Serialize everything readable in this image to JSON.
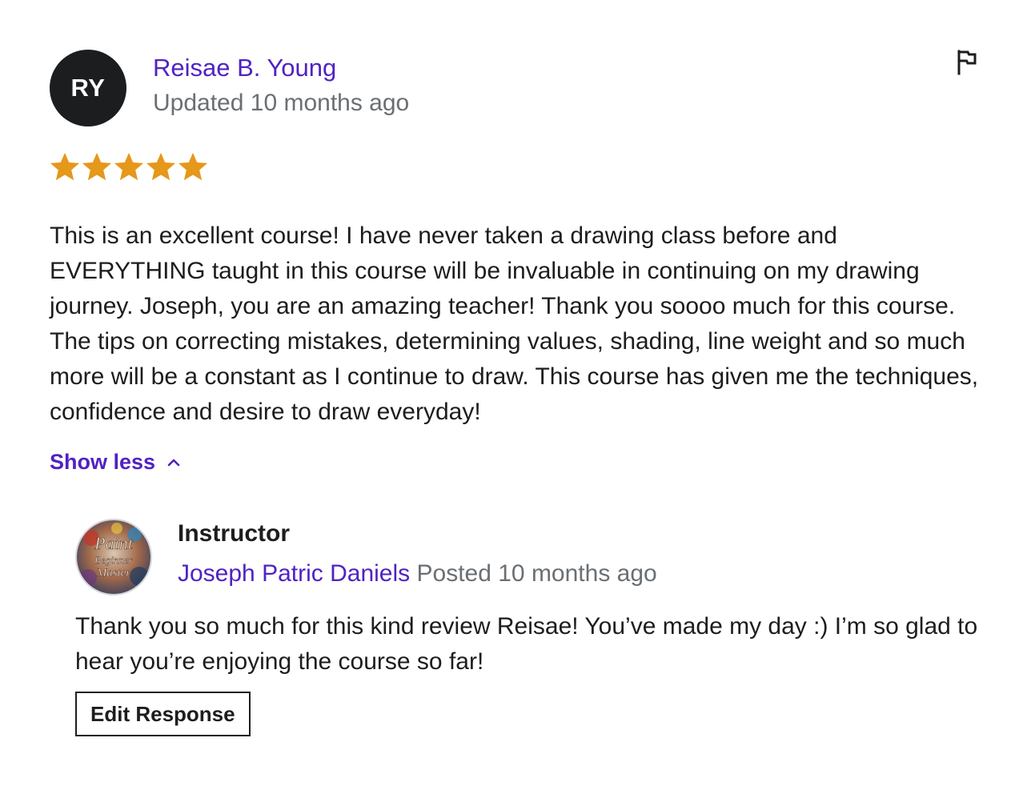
{
  "review": {
    "avatar_initials": "RY",
    "reviewer_name": "Reisae B. Young",
    "updated_text": "Updated 10 months ago",
    "rating": 5,
    "rating_max": 5,
    "star_color": "#e59819",
    "text": "This is an excellent course! I have never taken a drawing class before and EVERYTHING taught in this course will be invaluable in continuing on my drawing journey. Joseph, you are an amazing teacher! Thank you soooo much for this course. The tips on correcting mistakes, determining values, shading, line weight and so much more will be a constant as I continue to draw. This course has given me the techniques, confidence and desire to draw everyday!",
    "show_less_label": "Show less",
    "flag_icon": "flag-icon"
  },
  "response": {
    "role_label": "Instructor",
    "instructor_name": "Joseph Patric Daniels",
    "posted_text": "Posted 10 months ago",
    "text": "Thank you so much for this kind review Reisae! You’ve made my day :) I’m so glad to hear you’re enjoying the course so far!",
    "edit_button_label": "Edit Response",
    "avatar_text_lines": [
      "Paint",
      "Beginner",
      "Master"
    ]
  },
  "colors": {
    "accent": "#5022c3",
    "muted": "#6a6f73",
    "text": "#1c1d1f"
  }
}
